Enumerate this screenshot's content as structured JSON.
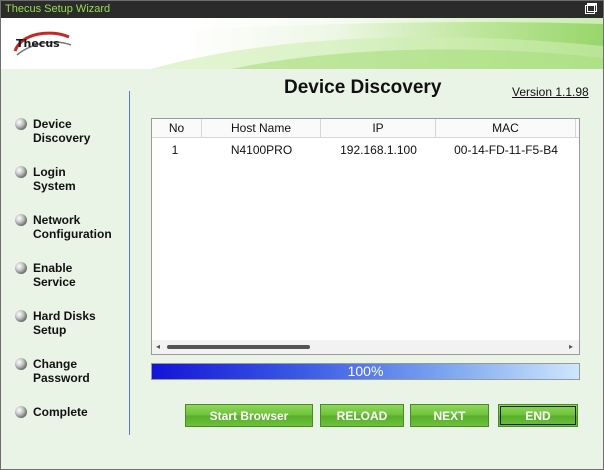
{
  "window": {
    "title": "Thecus Setup Wizard",
    "logo_text": "Thecus"
  },
  "page": {
    "title": "Device Discovery",
    "version": "Version 1.1.98"
  },
  "nav": {
    "items": [
      {
        "label": "Device\nDiscovery"
      },
      {
        "label": "Login\nSystem"
      },
      {
        "label": "Network\nConfiguration"
      },
      {
        "label": "Enable\nService"
      },
      {
        "label": "Hard Disks\nSetup"
      },
      {
        "label": "Change\nPassword"
      },
      {
        "label": "Complete"
      }
    ]
  },
  "table": {
    "columns": [
      "No",
      "Host Name",
      "IP",
      "MAC"
    ],
    "rows": [
      [
        "1",
        "N4100PRO",
        "192.168.1.100",
        "00-14-FD-11-F5-B4"
      ]
    ]
  },
  "progress": {
    "value": 100,
    "label": "100%"
  },
  "buttons": {
    "start_browser": "Start Browser",
    "reload": "RELOAD",
    "next": "NEXT",
    "end": "END"
  },
  "colors": {
    "title_text": "#9bdc54",
    "button_green": "#6cc23a",
    "progress_blue": "#1414d8"
  }
}
